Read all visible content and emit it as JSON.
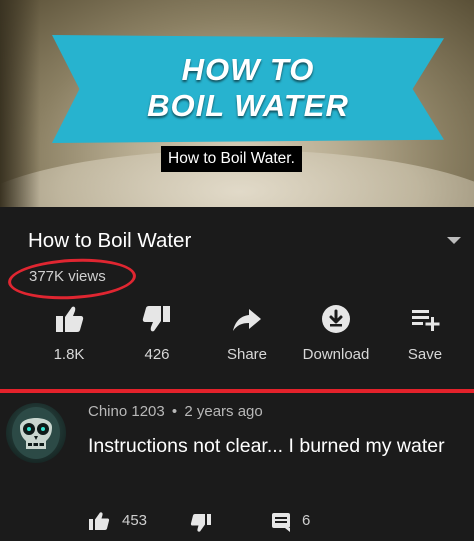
{
  "video": {
    "banner_line1": "HOW TO",
    "banner_line2": "BOIL WATER",
    "caption": "How to Boil Water.",
    "banner_color": "#27b3cf"
  },
  "info": {
    "title": "How to Boil Water",
    "views": "377K views",
    "highlight_color": "#e02631",
    "actions": [
      {
        "icon": "thumbs-up-icon",
        "label": "1.8K"
      },
      {
        "icon": "thumbs-down-icon",
        "label": "426"
      },
      {
        "icon": "share-icon",
        "label": "Share"
      },
      {
        "icon": "download-icon",
        "label": "Download"
      },
      {
        "icon": "playlist-add-icon",
        "label": "Save"
      }
    ]
  },
  "comment": {
    "author": "Chino 1203",
    "separator": "•",
    "time": "2 years ago",
    "text": "Instructions not clear... I burned my water",
    "likes": "453",
    "replies": "6"
  }
}
